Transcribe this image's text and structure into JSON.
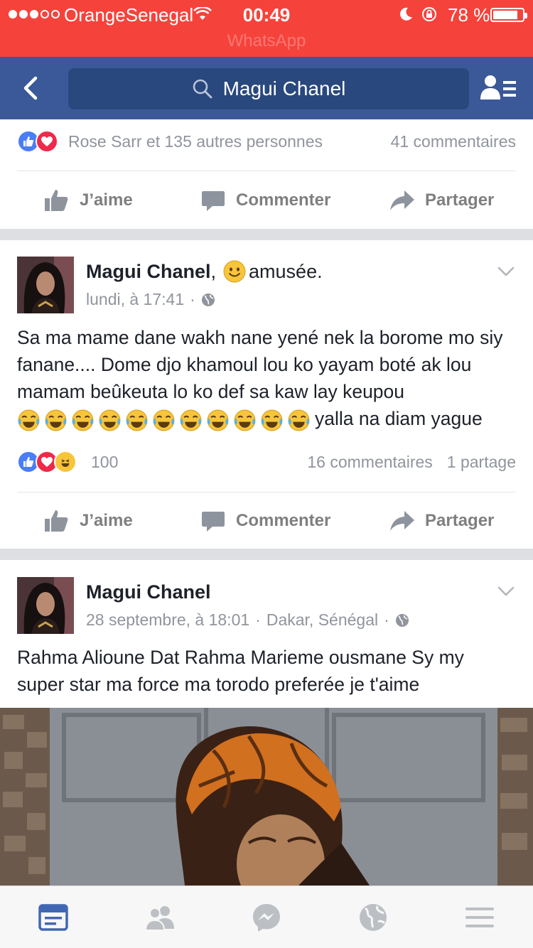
{
  "status_bar": {
    "carrier": "OrangeSenegal",
    "time": "00:49",
    "battery_pct": "78 %",
    "back_app": "WhatsApp",
    "signal_bars_filled": 3,
    "battery_level": 0.78
  },
  "nav": {
    "search_text": "Magui Chanel"
  },
  "post_prev": {
    "reaction_text": "Rose Sarr et 135 autres personnes",
    "comments": "41 commentaires"
  },
  "actions": {
    "like": "J’aime",
    "comment": "Commenter",
    "share": "Partager"
  },
  "post1": {
    "author": "Magui Chanel",
    "author_suffix": ",",
    "feeling": "amusée.",
    "time": "lundi, à 17:41",
    "privacy_separator": "·",
    "text": "Sa ma mame dane wakh nane yené nek la borome mo siy fanane.... Dome djo khamoul lou ko yayam boté ak lou mamam beûkeuta lo ko def sa kaw lay keupou",
    "text_tail": "yalla na diam yague",
    "emoji_count": 11,
    "reaction_count": "100",
    "comments": "16 commentaires",
    "shares": "1 partage"
  },
  "post2": {
    "author": "Magui Chanel",
    "time": "28 septembre, à 18:01",
    "location": "Dakar, Sénégal",
    "separator": "·",
    "text": "Rahma Alioune Dat Rahma Marieme ousmane Sy my super star ma force ma torodo preferée je t'aime"
  },
  "colors": {
    "status_bar": "#f5433b",
    "nav_bar": "#3b5998",
    "search_box": "#29487d",
    "like_blue": "#4a7df6",
    "love_red": "#f0284a",
    "tab_active": "#4267b2"
  },
  "tabs": [
    "news-feed-icon",
    "friends-icon",
    "messenger-icon",
    "notifications-globe-icon",
    "menu-icon"
  ]
}
